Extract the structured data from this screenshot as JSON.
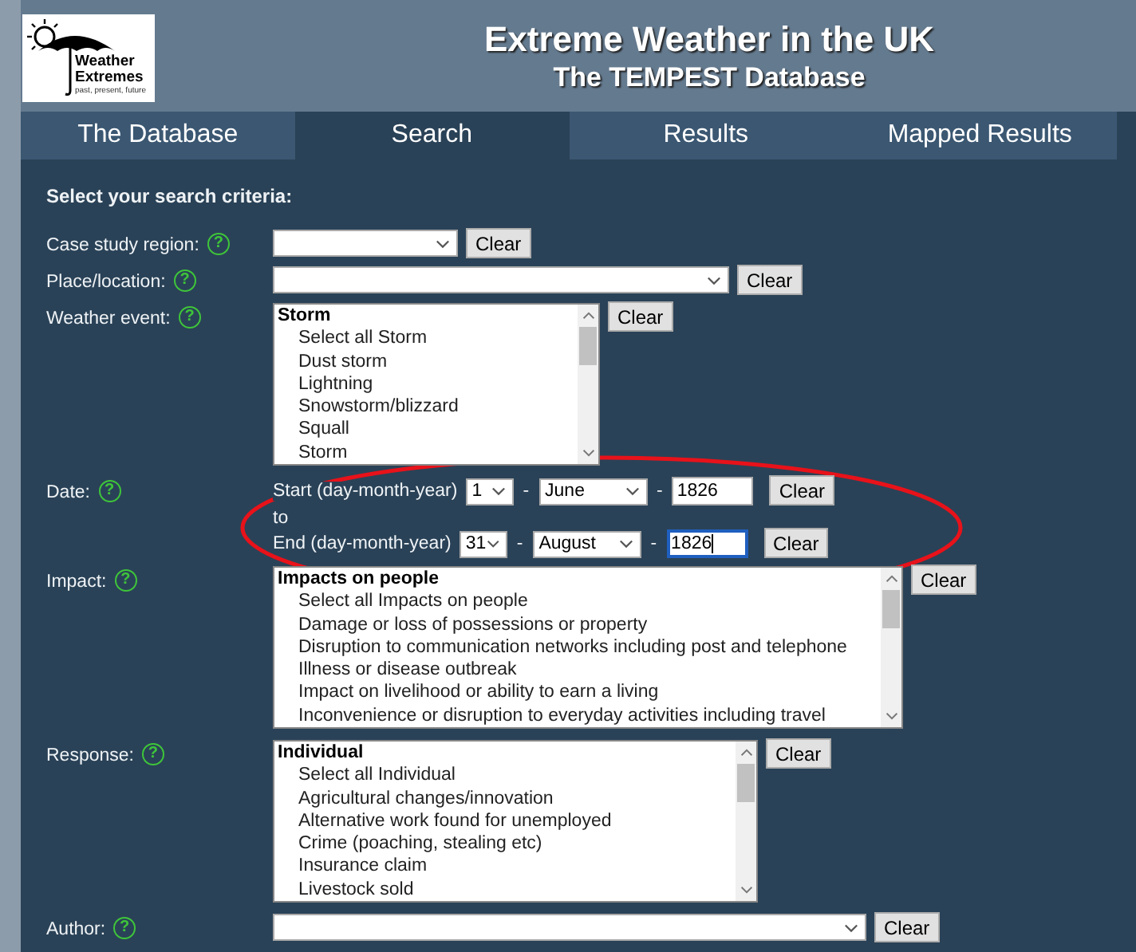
{
  "header": {
    "logo": {
      "line1": "Weather",
      "line2": "Extremes",
      "tagline": "past, present, future"
    },
    "title": "Extreme Weather in the UK",
    "subtitle": "The TEMPEST Database"
  },
  "tabs": [
    {
      "label": "The Database",
      "selected": false
    },
    {
      "label": "Search",
      "selected": true
    },
    {
      "label": "Results",
      "selected": false
    },
    {
      "label": "Mapped Results",
      "selected": false
    }
  ],
  "heading": "Select your search criteria:",
  "fields": [
    {
      "kind": "select",
      "label": "Case study region:",
      "help": "?",
      "button": "Clear"
    },
    {
      "kind": "select",
      "label": "Place/location:",
      "help": "?",
      "button": "Clear"
    },
    {
      "kind": "listbox",
      "label": "Weather event:",
      "help": "?",
      "group": "Storm",
      "options": [
        "Select all Storm",
        "Dust storm",
        "Lightning",
        "Snowstorm/blizzard",
        "Squall",
        "Storm"
      ],
      "button": "Clear"
    },
    {
      "kind": "date",
      "label": "Date:",
      "help": "?",
      "highlighted": true,
      "joiner": "to",
      "rows": [
        {
          "label": "Start (day-month-year)",
          "day": "1",
          "month": "June",
          "year": "1826",
          "focused": false,
          "button": "Clear"
        },
        {
          "label": "End (day-month-year)",
          "day": "31",
          "month": "August",
          "year": "1826",
          "focused": true,
          "button": "Clear"
        }
      ],
      "separator": "-"
    },
    {
      "kind": "listbox",
      "label": "Impact:",
      "help": "?",
      "group": "Impacts on people",
      "options": [
        "Select all Impacts on people",
        "Damage or loss of possessions or property",
        "Disruption to communication networks including post and telephone",
        "Illness or disease outbreak",
        "Impact on livelihood or ability to earn a living",
        "Inconvenience or disruption to everyday activities including travel"
      ],
      "button": "Clear"
    },
    {
      "kind": "listbox",
      "label": "Response:",
      "help": "?",
      "group": "Individual",
      "options": [
        "Select all Individual",
        "Agricultural changes/innovation",
        "Alternative work found for unemployed",
        "Crime (poaching, stealing etc)",
        "Insurance claim",
        "Livestock sold"
      ],
      "button": "Clear"
    },
    {
      "kind": "select",
      "label": "Author:",
      "help": "?",
      "button": "Clear"
    }
  ]
}
